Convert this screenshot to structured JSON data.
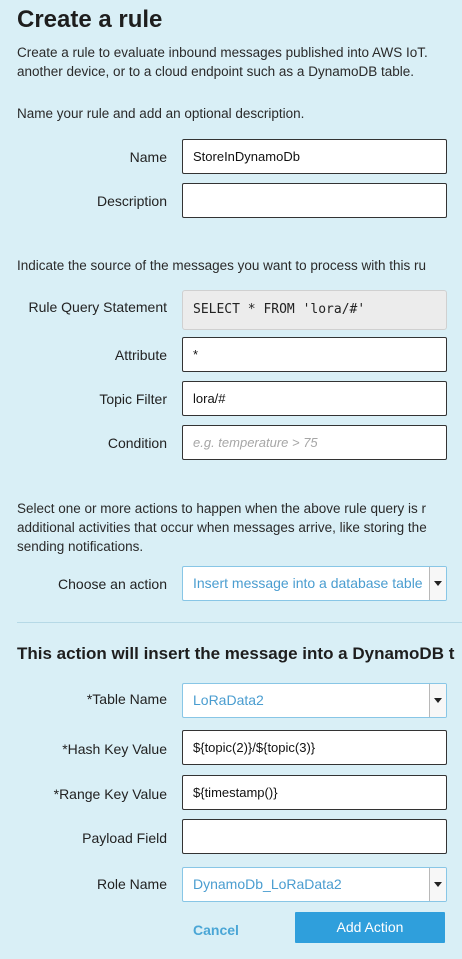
{
  "page": {
    "title": "Create a rule",
    "intro_line1": "Create a rule to evaluate inbound messages published into AWS IoT.",
    "intro_line2": "another device, or to a cloud endpoint such as a DynamoDB table.",
    "name_prompt": "Name your rule and add an optional description."
  },
  "rule": {
    "name_label": "Name",
    "name_value": "StoreInDynamoDb",
    "description_label": "Description",
    "description_value": ""
  },
  "source": {
    "prompt": "Indicate the source of the messages you want to process with this ru",
    "query_label": "Rule Query Statement",
    "query_value": "SELECT * FROM 'lora/#'",
    "attribute_label": "Attribute",
    "attribute_value": "*",
    "topic_label": "Topic Filter",
    "topic_value": "lora/#",
    "condition_label": "Condition",
    "condition_placeholder": "e.g. temperature > 75"
  },
  "actions": {
    "prompt_line1": "Select one or more actions to happen when the above rule query is r",
    "prompt_line2": "additional activities that occur when messages arrive, like storing the",
    "prompt_line3": "sending notifications.",
    "choose_label": "Choose an action",
    "choose_value": "Insert message into a database table"
  },
  "dynamo": {
    "heading": "This action will insert the message into a DynamoDB t",
    "table_label": "*Table Name",
    "table_value": "LoRaData2",
    "hash_label": "*Hash Key Value",
    "hash_value": "${topic(2)}/${topic(3)}",
    "range_label": "*Range Key Value",
    "range_value": "${timestamp()}",
    "payload_label": "Payload Field",
    "payload_value": "",
    "role_label": "Role Name",
    "role_value": "DynamoDb_LoRaData2"
  },
  "buttons": {
    "cancel": "Cancel",
    "add_action": "Add Action"
  },
  "colors": {
    "background": "#d9eff6",
    "accent": "#2f9fdc",
    "link": "#4aa6d6"
  }
}
